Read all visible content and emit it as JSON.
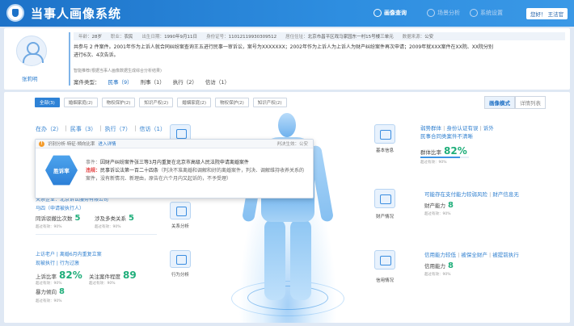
{
  "header": {
    "title": "当事人画像系统",
    "nav": [
      {
        "label": "画像查询",
        "icon": "portrait-search-icon",
        "active": true
      },
      {
        "label": "场景分析",
        "icon": "scene-analysis-icon",
        "active": false
      },
      {
        "label": "系统设置",
        "icon": "settings-icon",
        "active": false
      }
    ],
    "user": "您好！ 王法官"
  },
  "profile": {
    "name": "张莉明",
    "info": [
      {
        "k": "年龄：",
        "v": "28岁"
      },
      {
        "k": "职业：",
        "v": "农民"
      },
      {
        "k": "出生日期：",
        "v": "1990年9月11日"
      },
      {
        "k": "身份证号：",
        "v": "11012119930309512"
      },
      {
        "k": "居住住址：",
        "v": "北京市昌平区戏马家园东一村15号楼三单元"
      },
      {
        "k": "数据来源：",
        "v": "公安"
      }
    ],
    "desc1": "共参与 2 件案件。2001年作为上诉人就合同纠纷案查询王五进行民事一审诉讼，案号为XXXXXXX；2002年作为上诉人为上诉人为财产纠纷案件再次申请；2009年就XXX案件在XX院、XX院分别",
    "desc2": "进行6次、4次告诉。",
    "rec": "智能推荐(根据当事人画像数据生成综合分析结果)",
    "case_types": [
      {
        "label": "案件类型：",
        "hl": false
      },
      {
        "label": "民事（9）",
        "hl": true
      },
      {
        "label": "刑事（1）",
        "hl": false
      },
      {
        "label": "执行（2）",
        "hl": false
      },
      {
        "label": "信访（1）",
        "hl": false
      }
    ]
  },
  "filters": [
    "全部(3)",
    "婚姻家庭(2)",
    "物权保护(2)",
    "知识产权(2)",
    "婚姻家庭(2)",
    "物权保护(2)",
    "知识产权(2)"
  ],
  "modes": [
    "画像模式",
    "详情列表"
  ],
  "left_tabs": [
    "在办（2）",
    "民事（3）",
    "执行（7）",
    "信访（1）"
  ],
  "popup": {
    "head": "识别分析·特征·倾向比率",
    "link": "进入详情",
    "date": "判决生效：公安",
    "badge": "胜诉率",
    "case_k": "事件：",
    "case_v": "因财产纠纷案件张三等3月内重复在北京市高级人民法院申请离婚案件",
    "tag": "违规：",
    "text_em": "民事诉讼法第一百二十四条",
    "text_rest": "（判决不准离婚和调解和好的离婚案件，判决、调解维持收养关系的案件，没有新情况、新理由，原告在六个月内又起诉的，不予受理）"
  },
  "left_mid": {
    "line1": "关系企业：北京诉讼服务有限公司",
    "line2": "马四（申请被执行人）",
    "stats": [
      {
        "label": "同诉驳撤比次数",
        "value": "5",
        "sub": "超过有效：90%"
      },
      {
        "label": "涉及多类关系",
        "value": "5",
        "sub": "超过有效：90%"
      }
    ]
  },
  "left_bottom": {
    "tags": [
      "上访老户",
      "离婚6月内重复立案",
      "现被执行",
      "行为过激"
    ],
    "stats": [
      {
        "label": "上诉比率",
        "value": "82%",
        "sub": "超过有效：90%"
      },
      {
        "label": "关注案件程度",
        "value": "89",
        "sub": "超过有效：90%"
      },
      {
        "label": "暴力倾向",
        "value": "8",
        "sub": "超过有效：90%"
      }
    ]
  },
  "mid_modules": [
    {
      "label": "关系分析",
      "icon": "relation-analysis-icon"
    },
    {
      "label": "行为分析",
      "icon": "behavior-analysis-icon"
    }
  ],
  "right": [
    {
      "icon": "basic-info-icon",
      "icon_label": "基本信息",
      "text": [
        "弱势群体",
        "身份认证有误",
        "诉外",
        "民事合同类案件不清晰"
      ],
      "stat_label": "群体比率",
      "stat_value": "82%",
      "sub": "超过有效：90%",
      "progress": 0.82
    },
    {
      "icon": "property-icon",
      "icon_label": "财产情况",
      "text": [
        "可能存在支付能力较弱风险",
        "财产信息无"
      ],
      "stat_label": "财产能力",
      "stat_value": "8",
      "sub": "超过有效：90%"
    },
    {
      "icon": "credit-icon",
      "icon_label": "信用情况",
      "text": [
        "信用能力较低",
        "被保全财产",
        "被提前执行"
      ],
      "stat_label": "信用能力",
      "stat_value": "8",
      "sub": "超过有效：90%"
    }
  ]
}
